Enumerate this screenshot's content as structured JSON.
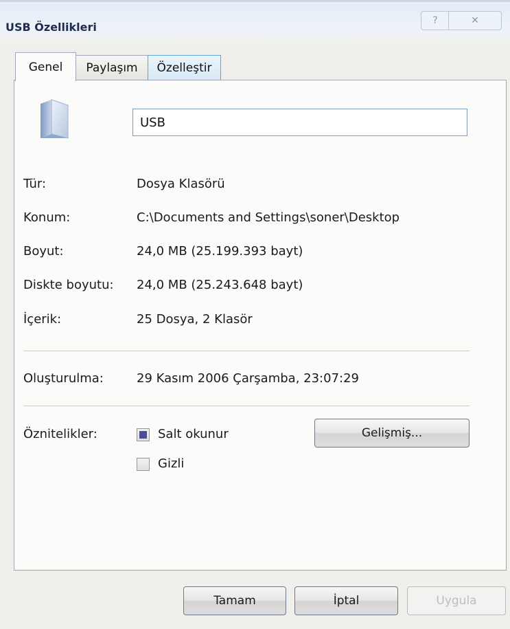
{
  "window": {
    "title": "USB Özellikleri",
    "help_glyph": "?",
    "close_glyph": "✕"
  },
  "tabs": [
    {
      "label": "Genel",
      "active": true
    },
    {
      "label": "Paylaşım",
      "active": false
    },
    {
      "label": "Özelleştir",
      "active": false
    }
  ],
  "general": {
    "name_value": "USB",
    "rows": [
      {
        "label": "Tür:",
        "value": "Dosya Klasörü"
      },
      {
        "label": "Konum:",
        "value": "C:\\Documents and Settings\\soner\\Desktop"
      },
      {
        "label": "Boyut:",
        "value": "24,0 MB (25.199.393 bayt)"
      },
      {
        "label": "Diskte boyutu:",
        "value": "24,0 MB (25.243.648 bayt)"
      },
      {
        "label": "İçerik:",
        "value": "25 Dosya, 2 Klasör"
      }
    ],
    "created": {
      "label": "Oluşturulma:",
      "value": "29 Kasım 2006 Çarşamba, 23:07:29"
    },
    "attributes": {
      "label": "Öznitelikler:",
      "readonly": {
        "label": "Salt okunur",
        "checked": true
      },
      "hidden": {
        "label": "Gizli",
        "checked": false
      },
      "advanced_button": "Gelişmiş..."
    }
  },
  "footer": {
    "ok": "Tamam",
    "cancel": "İptal",
    "apply": "Uygula"
  },
  "icons": {
    "folder": "folder-icon",
    "help": "help-icon",
    "close": "close-icon"
  },
  "colors": {
    "titlebar": "#e4edf7",
    "dialog_bg": "#f0efeb",
    "checkbox_fill": "#4b4d9c",
    "title_text": "#1f2d4d"
  }
}
